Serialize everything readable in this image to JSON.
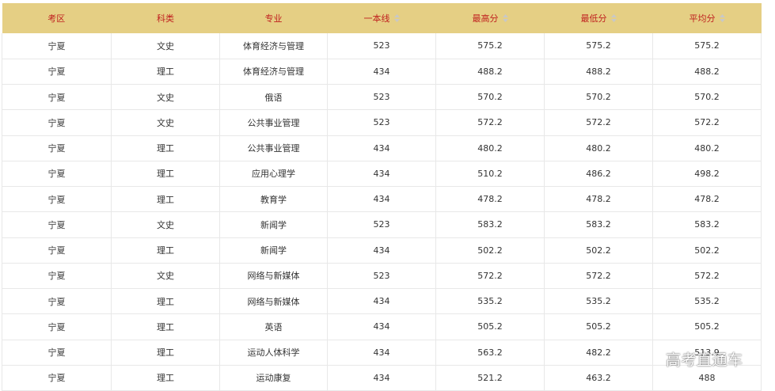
{
  "table": {
    "columns": [
      {
        "label": "考区",
        "sortable": false
      },
      {
        "label": "科类",
        "sortable": false
      },
      {
        "label": "专业",
        "sortable": false
      },
      {
        "label": "一本线",
        "sortable": true
      },
      {
        "label": "最高分",
        "sortable": true
      },
      {
        "label": "最低分",
        "sortable": true
      },
      {
        "label": "平均分",
        "sortable": true
      }
    ],
    "rows": [
      [
        "宁夏",
        "文史",
        "体育经济与管理",
        "523",
        "575.2",
        "575.2",
        "575.2"
      ],
      [
        "宁夏",
        "理工",
        "体育经济与管理",
        "434",
        "488.2",
        "488.2",
        "488.2"
      ],
      [
        "宁夏",
        "文史",
        "俄语",
        "523",
        "570.2",
        "570.2",
        "570.2"
      ],
      [
        "宁夏",
        "文史",
        "公共事业管理",
        "523",
        "572.2",
        "572.2",
        "572.2"
      ],
      [
        "宁夏",
        "理工",
        "公共事业管理",
        "434",
        "480.2",
        "480.2",
        "480.2"
      ],
      [
        "宁夏",
        "理工",
        "应用心理学",
        "434",
        "510.2",
        "486.2",
        "498.2"
      ],
      [
        "宁夏",
        "理工",
        "教育学",
        "434",
        "478.2",
        "478.2",
        "478.2"
      ],
      [
        "宁夏",
        "文史",
        "新闻学",
        "523",
        "583.2",
        "583.2",
        "583.2"
      ],
      [
        "宁夏",
        "理工",
        "新闻学",
        "434",
        "502.2",
        "502.2",
        "502.2"
      ],
      [
        "宁夏",
        "文史",
        "网络与新媒体",
        "523",
        "572.2",
        "572.2",
        "572.2"
      ],
      [
        "宁夏",
        "理工",
        "网络与新媒体",
        "434",
        "535.2",
        "535.2",
        "535.2"
      ],
      [
        "宁夏",
        "理工",
        "英语",
        "434",
        "505.2",
        "505.2",
        "505.2"
      ],
      [
        "宁夏",
        "理工",
        "运动人体科学",
        "434",
        "563.2",
        "482.2",
        "513.9"
      ],
      [
        "宁夏",
        "理工",
        "运动康复",
        "434",
        "521.2",
        "463.2",
        "488"
      ]
    ]
  },
  "watermark": {
    "text": "高考直通车"
  },
  "colors": {
    "header_bg": "#e5cf84",
    "header_text": "#c0201f",
    "cell_text": "#333333",
    "grid_line": "#e8e8e8",
    "sort_icon": "#c8c8c8"
  }
}
